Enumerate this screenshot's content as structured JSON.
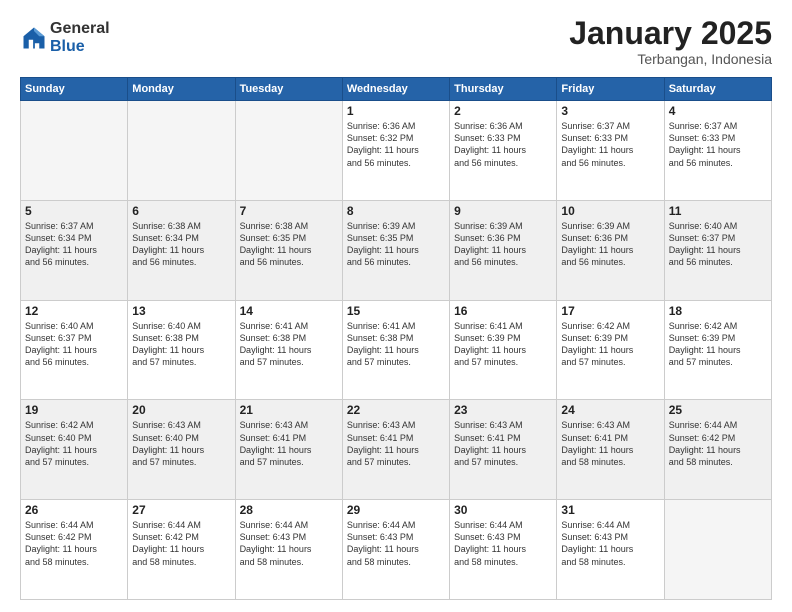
{
  "logo": {
    "general": "General",
    "blue": "Blue"
  },
  "header": {
    "month": "January 2025",
    "location": "Terbangan, Indonesia"
  },
  "weekdays": [
    "Sunday",
    "Monday",
    "Tuesday",
    "Wednesday",
    "Thursday",
    "Friday",
    "Saturday"
  ],
  "weeks": [
    [
      {
        "day": "",
        "info": ""
      },
      {
        "day": "",
        "info": ""
      },
      {
        "day": "",
        "info": ""
      },
      {
        "day": "1",
        "info": "Sunrise: 6:36 AM\nSunset: 6:32 PM\nDaylight: 11 hours\nand 56 minutes."
      },
      {
        "day": "2",
        "info": "Sunrise: 6:36 AM\nSunset: 6:33 PM\nDaylight: 11 hours\nand 56 minutes."
      },
      {
        "day": "3",
        "info": "Sunrise: 6:37 AM\nSunset: 6:33 PM\nDaylight: 11 hours\nand 56 minutes."
      },
      {
        "day": "4",
        "info": "Sunrise: 6:37 AM\nSunset: 6:33 PM\nDaylight: 11 hours\nand 56 minutes."
      }
    ],
    [
      {
        "day": "5",
        "info": "Sunrise: 6:37 AM\nSunset: 6:34 PM\nDaylight: 11 hours\nand 56 minutes."
      },
      {
        "day": "6",
        "info": "Sunrise: 6:38 AM\nSunset: 6:34 PM\nDaylight: 11 hours\nand 56 minutes."
      },
      {
        "day": "7",
        "info": "Sunrise: 6:38 AM\nSunset: 6:35 PM\nDaylight: 11 hours\nand 56 minutes."
      },
      {
        "day": "8",
        "info": "Sunrise: 6:39 AM\nSunset: 6:35 PM\nDaylight: 11 hours\nand 56 minutes."
      },
      {
        "day": "9",
        "info": "Sunrise: 6:39 AM\nSunset: 6:36 PM\nDaylight: 11 hours\nand 56 minutes."
      },
      {
        "day": "10",
        "info": "Sunrise: 6:39 AM\nSunset: 6:36 PM\nDaylight: 11 hours\nand 56 minutes."
      },
      {
        "day": "11",
        "info": "Sunrise: 6:40 AM\nSunset: 6:37 PM\nDaylight: 11 hours\nand 56 minutes."
      }
    ],
    [
      {
        "day": "12",
        "info": "Sunrise: 6:40 AM\nSunset: 6:37 PM\nDaylight: 11 hours\nand 56 minutes."
      },
      {
        "day": "13",
        "info": "Sunrise: 6:40 AM\nSunset: 6:38 PM\nDaylight: 11 hours\nand 57 minutes."
      },
      {
        "day": "14",
        "info": "Sunrise: 6:41 AM\nSunset: 6:38 PM\nDaylight: 11 hours\nand 57 minutes."
      },
      {
        "day": "15",
        "info": "Sunrise: 6:41 AM\nSunset: 6:38 PM\nDaylight: 11 hours\nand 57 minutes."
      },
      {
        "day": "16",
        "info": "Sunrise: 6:41 AM\nSunset: 6:39 PM\nDaylight: 11 hours\nand 57 minutes."
      },
      {
        "day": "17",
        "info": "Sunrise: 6:42 AM\nSunset: 6:39 PM\nDaylight: 11 hours\nand 57 minutes."
      },
      {
        "day": "18",
        "info": "Sunrise: 6:42 AM\nSunset: 6:39 PM\nDaylight: 11 hours\nand 57 minutes."
      }
    ],
    [
      {
        "day": "19",
        "info": "Sunrise: 6:42 AM\nSunset: 6:40 PM\nDaylight: 11 hours\nand 57 minutes."
      },
      {
        "day": "20",
        "info": "Sunrise: 6:43 AM\nSunset: 6:40 PM\nDaylight: 11 hours\nand 57 minutes."
      },
      {
        "day": "21",
        "info": "Sunrise: 6:43 AM\nSunset: 6:41 PM\nDaylight: 11 hours\nand 57 minutes."
      },
      {
        "day": "22",
        "info": "Sunrise: 6:43 AM\nSunset: 6:41 PM\nDaylight: 11 hours\nand 57 minutes."
      },
      {
        "day": "23",
        "info": "Sunrise: 6:43 AM\nSunset: 6:41 PM\nDaylight: 11 hours\nand 57 minutes."
      },
      {
        "day": "24",
        "info": "Sunrise: 6:43 AM\nSunset: 6:41 PM\nDaylight: 11 hours\nand 58 minutes."
      },
      {
        "day": "25",
        "info": "Sunrise: 6:44 AM\nSunset: 6:42 PM\nDaylight: 11 hours\nand 58 minutes."
      }
    ],
    [
      {
        "day": "26",
        "info": "Sunrise: 6:44 AM\nSunset: 6:42 PM\nDaylight: 11 hours\nand 58 minutes."
      },
      {
        "day": "27",
        "info": "Sunrise: 6:44 AM\nSunset: 6:42 PM\nDaylight: 11 hours\nand 58 minutes."
      },
      {
        "day": "28",
        "info": "Sunrise: 6:44 AM\nSunset: 6:43 PM\nDaylight: 11 hours\nand 58 minutes."
      },
      {
        "day": "29",
        "info": "Sunrise: 6:44 AM\nSunset: 6:43 PM\nDaylight: 11 hours\nand 58 minutes."
      },
      {
        "day": "30",
        "info": "Sunrise: 6:44 AM\nSunset: 6:43 PM\nDaylight: 11 hours\nand 58 minutes."
      },
      {
        "day": "31",
        "info": "Sunrise: 6:44 AM\nSunset: 6:43 PM\nDaylight: 11 hours\nand 58 minutes."
      },
      {
        "day": "",
        "info": ""
      }
    ]
  ]
}
